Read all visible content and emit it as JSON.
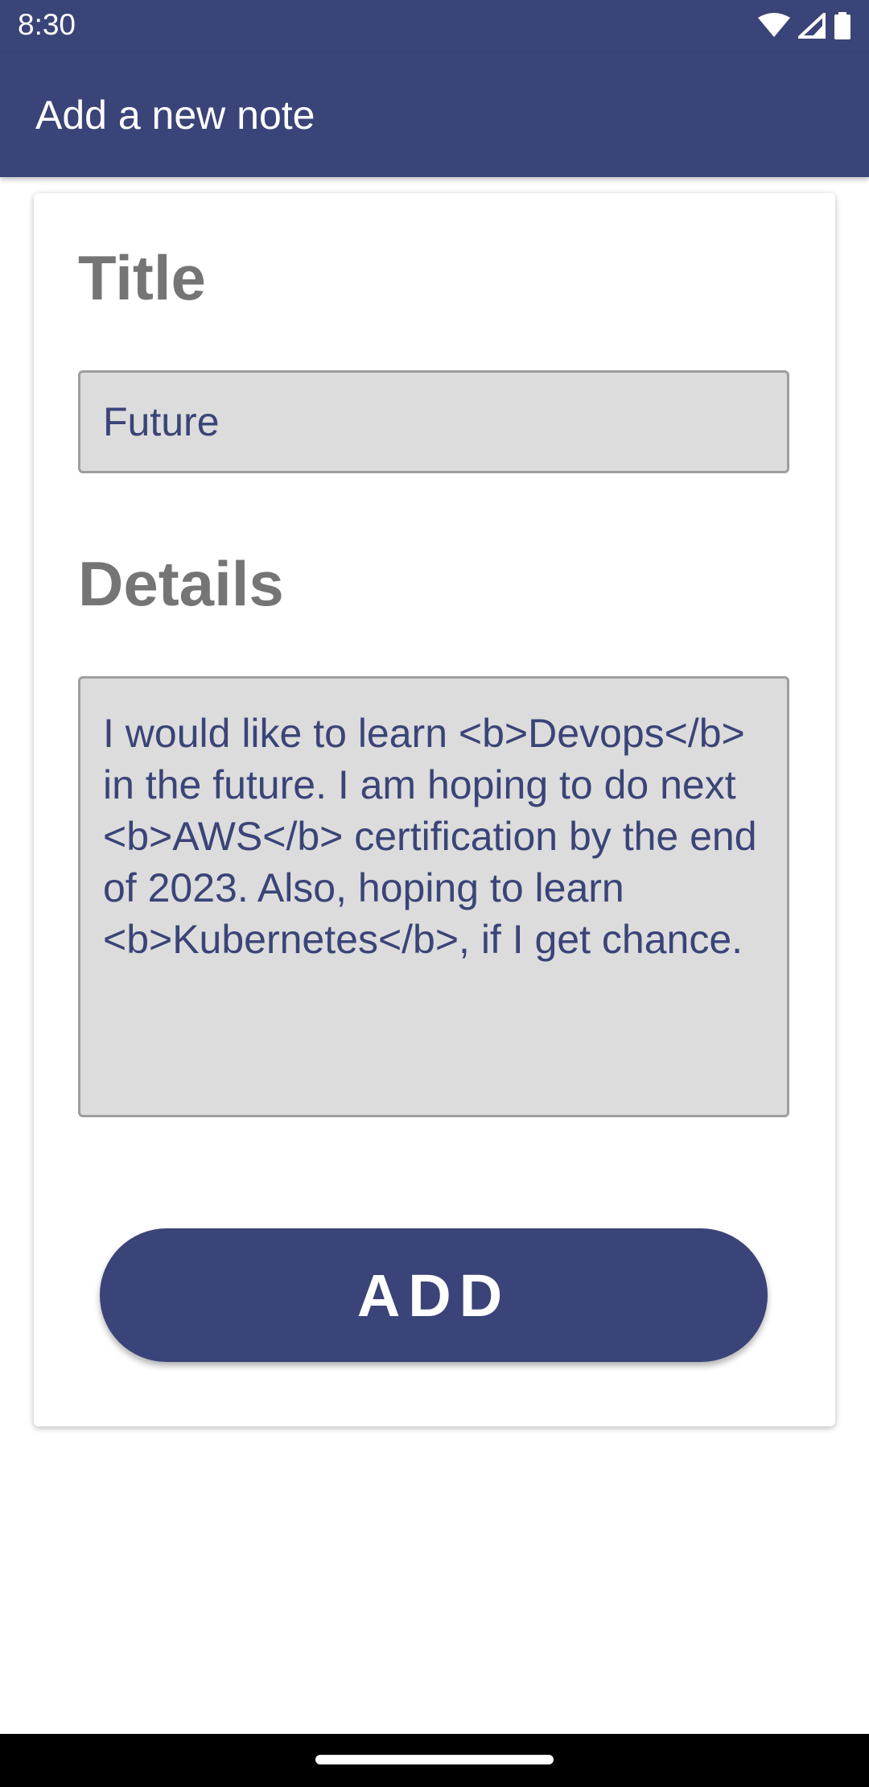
{
  "status_bar": {
    "time": "8:30",
    "icons": [
      "wifi-icon",
      "signal-icon",
      "battery-icon"
    ]
  },
  "app_bar": {
    "title": "Add a new note"
  },
  "form": {
    "title_label": "Title",
    "title_value": "Future",
    "details_label": "Details",
    "details_value": "I would like to learn <b>Devops</b> in the future. I am hoping to do next <b>AWS</b> certification by the end of 2023. Also, hoping to learn <b>Kubernetes</b>, if I get chance.",
    "add_button_label": "ADD"
  },
  "colors": {
    "primary": "#3a4478",
    "label_gray": "#757575",
    "field_background": "#dcdcdc"
  }
}
